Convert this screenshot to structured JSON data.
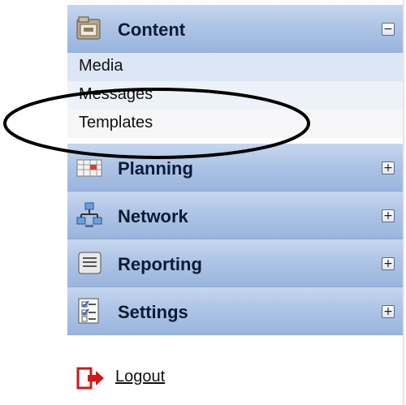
{
  "sidebar": {
    "sections": [
      {
        "label": "Content",
        "icon": "folder-icon",
        "toggle": "−",
        "expanded": true
      },
      {
        "label": "Planning",
        "icon": "calendar-icon",
        "toggle": "+",
        "expanded": false
      },
      {
        "label": "Network",
        "icon": "network-icon",
        "toggle": "+",
        "expanded": false
      },
      {
        "label": "Reporting",
        "icon": "report-scroll-icon",
        "toggle": "+",
        "expanded": false
      },
      {
        "label": "Settings",
        "icon": "settings-checklist-icon",
        "toggle": "+",
        "expanded": false
      }
    ],
    "content_items": [
      {
        "label": "Media"
      },
      {
        "label": "Messages"
      },
      {
        "label": "Templates"
      }
    ],
    "logout": {
      "label": "Logout",
      "icon": "logout-icon"
    }
  },
  "colors": {
    "section_gradient_top": "#c6d6ee",
    "section_gradient_bottom": "#9ab4dd",
    "annotation_ellipse": "#000000",
    "logout_icon": "#d01818"
  }
}
